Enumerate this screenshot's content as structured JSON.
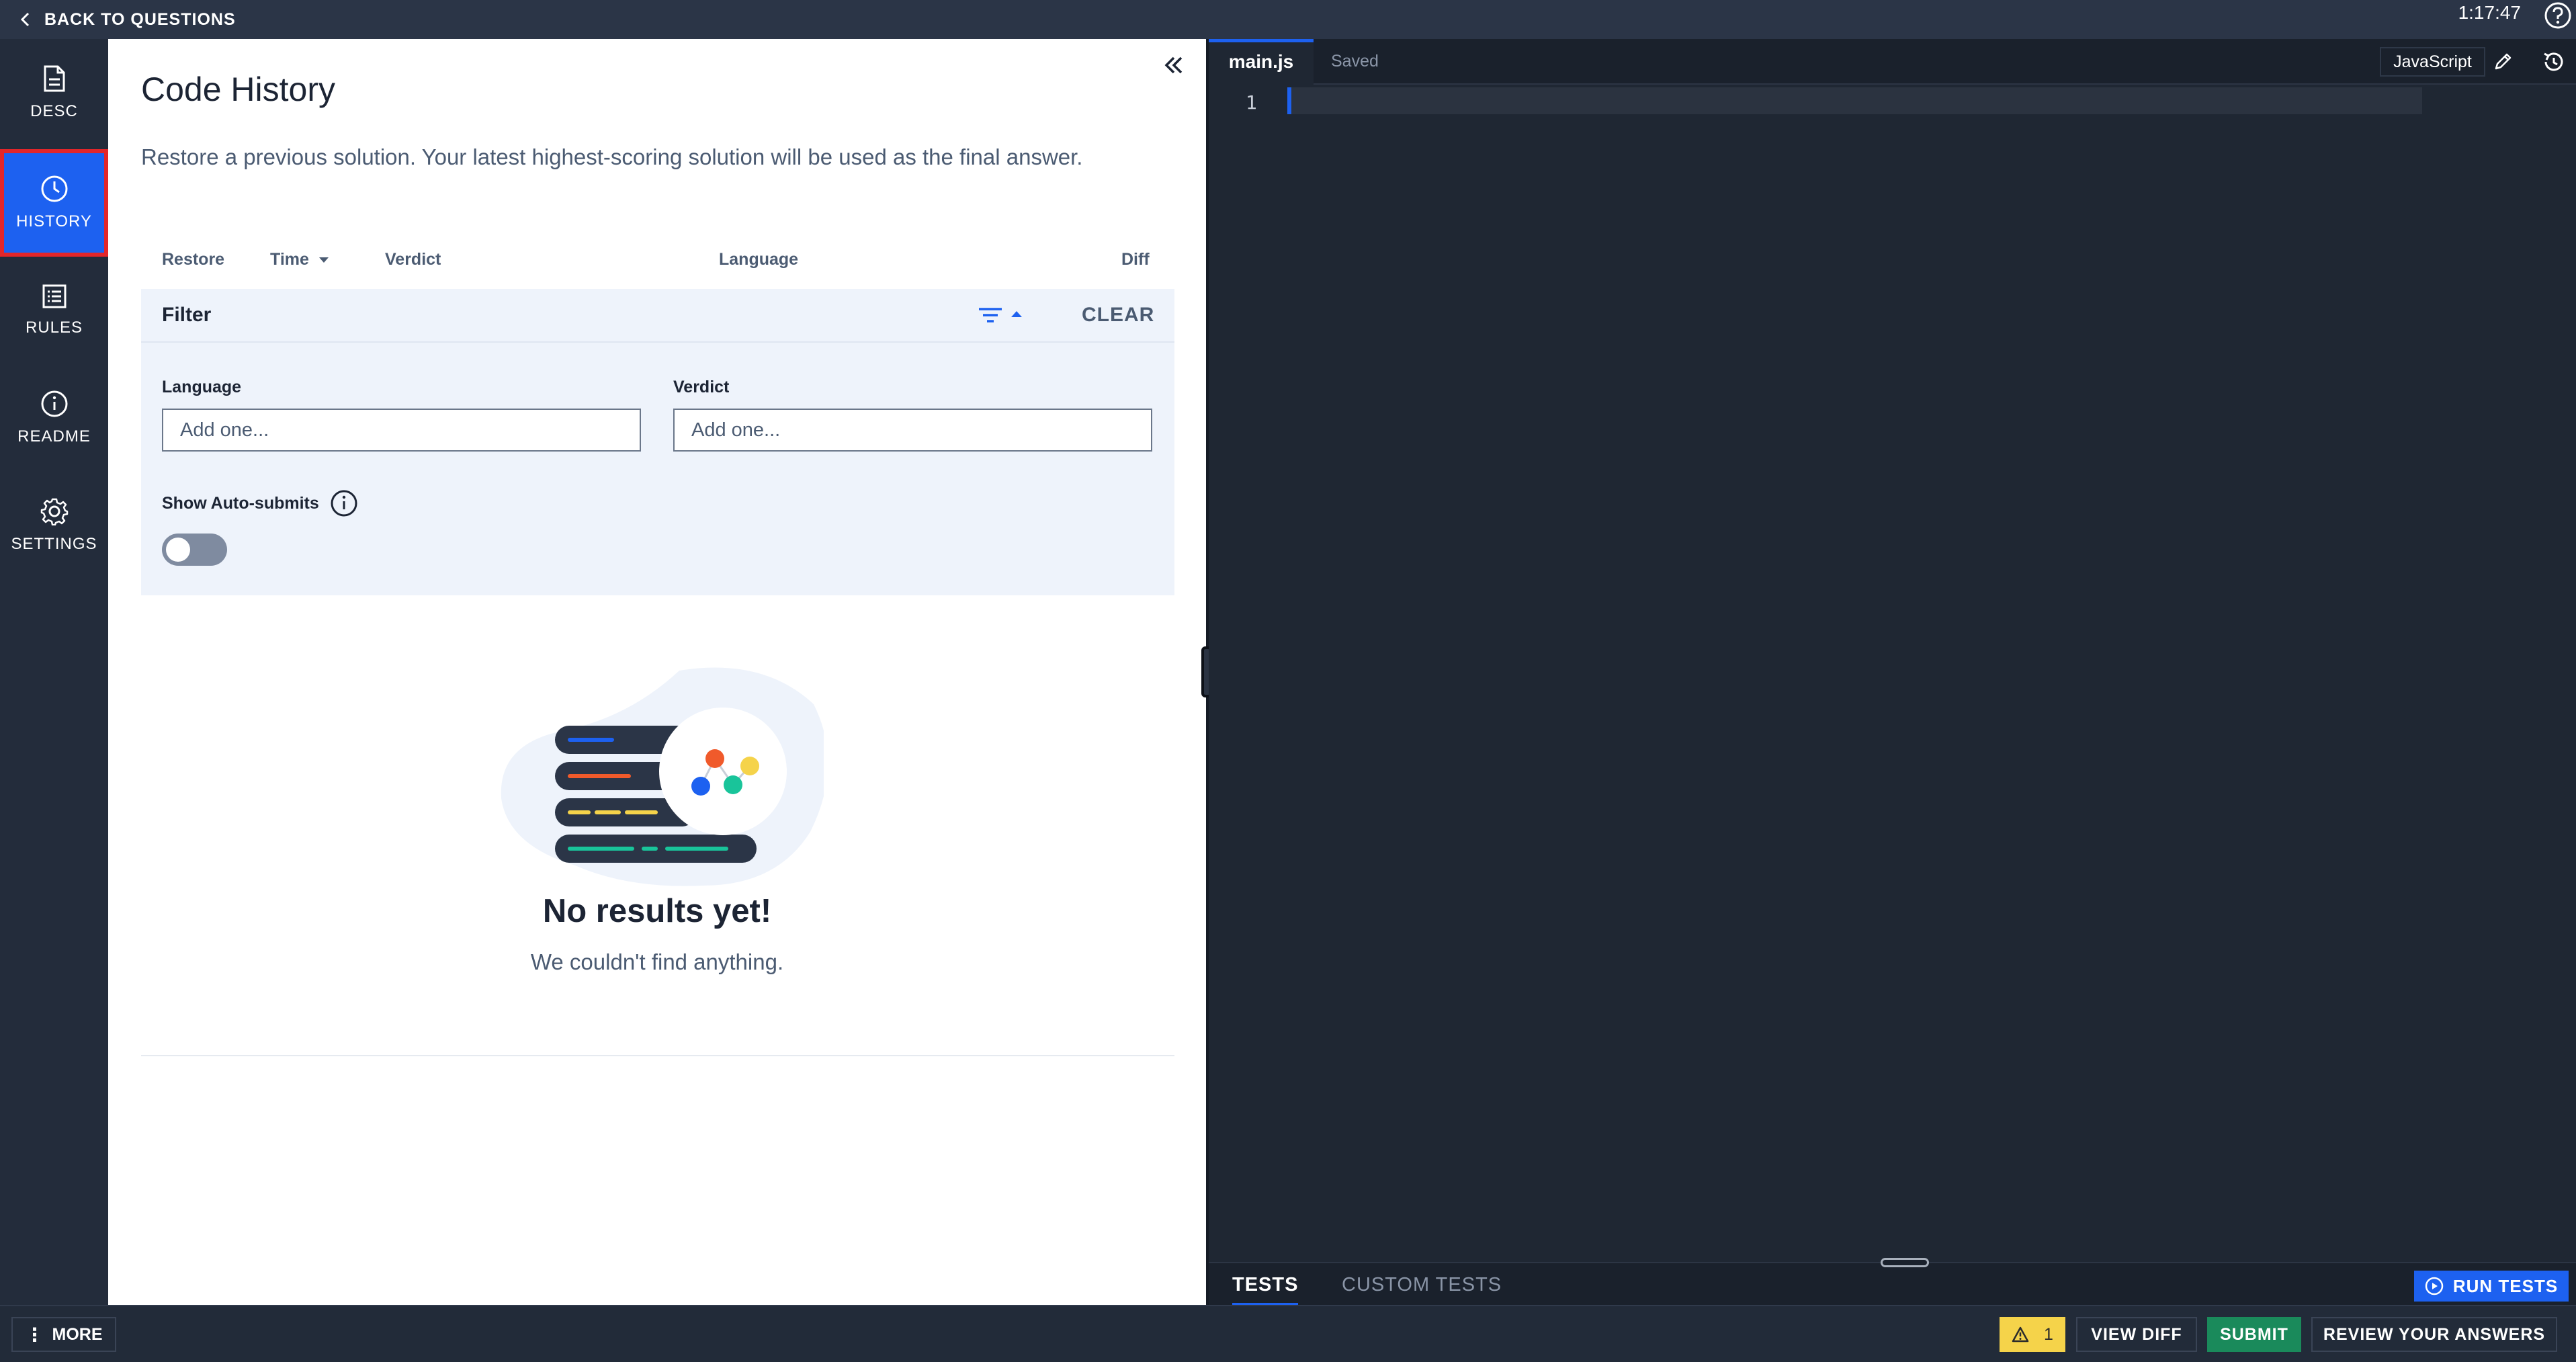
{
  "topbar": {
    "back_label": "BACK TO QUESTIONS",
    "timer": "1:17:47"
  },
  "leftnav": {
    "items": [
      {
        "label": "DESC",
        "icon": "document-icon",
        "active": false
      },
      {
        "label": "HISTORY",
        "icon": "clock-icon",
        "active": true
      },
      {
        "label": "RULES",
        "icon": "list-icon",
        "active": false
      },
      {
        "label": "README",
        "icon": "info-icon",
        "active": false
      },
      {
        "label": "SETTINGS",
        "icon": "gear-icon",
        "active": false
      }
    ]
  },
  "history": {
    "title": "Code History",
    "subtitle": "Restore a previous solution. Your latest highest-scoring solution will be used as the final answer.",
    "columns": {
      "restore": "Restore",
      "time": "Time",
      "verdict": "Verdict",
      "language": "Language",
      "diff": "Diff"
    },
    "filter": {
      "label": "Filter",
      "clear_label": "CLEAR",
      "language_label": "Language",
      "language_placeholder": "Add one...",
      "verdict_label": "Verdict",
      "verdict_placeholder": "Add one...",
      "auto_submits_label": "Show Auto-submits",
      "auto_submits_on": false
    },
    "empty": {
      "title": "No results yet!",
      "subtitle": "We couldn't find anything."
    }
  },
  "editor": {
    "file_tab": "main.js",
    "status": "Saved",
    "language": "JavaScript",
    "line_numbers": [
      "1"
    ]
  },
  "tests": {
    "tab_tests": "TESTS",
    "tab_custom": "CUSTOM TESTS",
    "run_label": "RUN TESTS"
  },
  "bottombar": {
    "more_label": "MORE",
    "warning_count": "1",
    "view_diff_label": "VIEW DIFF",
    "submit_label": "SUBMIT",
    "review_label": "REVIEW YOUR ANSWERS"
  },
  "colors": {
    "accent": "#1d61f0",
    "active_outline": "#e3262a",
    "submit_green": "#1a8a5b",
    "warning_yellow": "#f5d34a"
  }
}
